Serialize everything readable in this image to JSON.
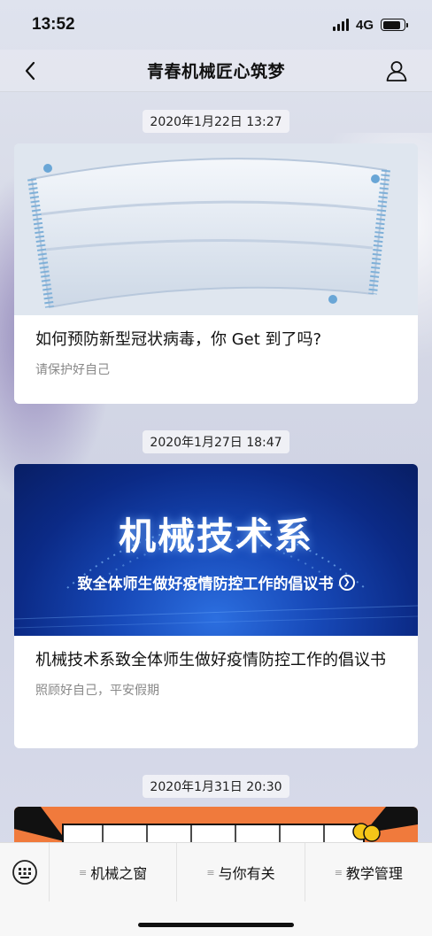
{
  "status": {
    "time": "13:52",
    "network": "4G"
  },
  "nav": {
    "title": "青春机械匠心筑梦"
  },
  "messages": [
    {
      "timestamp": "2020年1月22日 13:27",
      "title": "如何预防新型冠状病毒，你 Get 到了吗?",
      "subtitle": "请保护好自己"
    },
    {
      "timestamp": "2020年1月27日 18:47",
      "banner_title": "机械技术系",
      "banner_subtitle": "致全体师生做好疫情防控工作的倡议书",
      "title": "机械技术系致全体师生做好疫情防控工作的倡议书",
      "subtitle": "照顾好自己，平安假期"
    },
    {
      "timestamp": "2020年1月31日 20:30"
    }
  ],
  "menu": [
    {
      "label": "机械之窗"
    },
    {
      "label": "与你有关"
    },
    {
      "label": "教学管理"
    }
  ],
  "colors": {
    "banner": "#0b2a86",
    "orange": "#f07a3c"
  },
  "icons": [
    "back-chevron-icon",
    "user-icon",
    "keyboard-icon",
    "menu-lines-icon",
    "chevron-right-circle-icon"
  ]
}
